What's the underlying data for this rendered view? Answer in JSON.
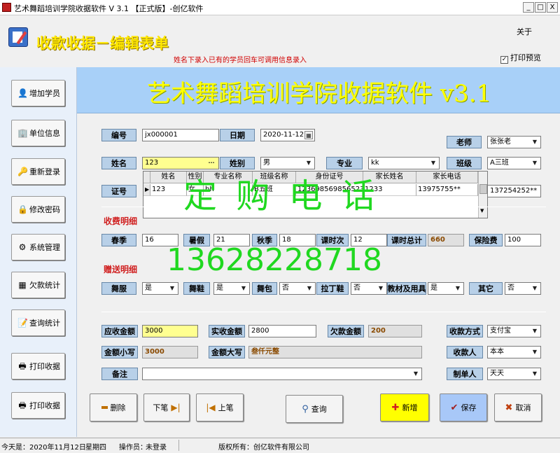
{
  "window": {
    "title": "艺术舞蹈培训学院收据软件 V 3.1 【正式版】-创亿软件",
    "btn_min": "_",
    "btn_max": "□",
    "btn_close": "X"
  },
  "header": {
    "title": "收款收据－编辑表单",
    "hint": "姓名下录入已有的学员回车可调用信息录入",
    "about": "关于",
    "print_preview": "打印预览",
    "print_preview_checked": "✓"
  },
  "banner": {
    "title": "艺术舞蹈培训学院收据软件 v3.1"
  },
  "sidebar": {
    "items": [
      {
        "label": "增加学员",
        "icon": "add-student-icon",
        "glyph": "👤"
      },
      {
        "label": "单位信息",
        "icon": "company-info-icon",
        "glyph": "🏢"
      },
      {
        "label": "重新登录",
        "icon": "relogin-icon",
        "glyph": "🔑"
      },
      {
        "label": "修改密码",
        "icon": "password-icon",
        "glyph": "🔒"
      },
      {
        "label": "系统管理",
        "icon": "system-icon",
        "glyph": "⚙"
      },
      {
        "label": "欠款统计",
        "icon": "debt-stat-icon",
        "glyph": "▦"
      },
      {
        "label": "查询统计",
        "icon": "query-stat-icon",
        "glyph": "📝"
      },
      {
        "label": "打印收据",
        "icon": "printer-icon",
        "glyph": "🖶"
      },
      {
        "label": "打印收据",
        "icon": "printer-icon",
        "glyph": "🖶"
      }
    ]
  },
  "form": {
    "number": {
      "label": "编号",
      "value": "jx000001"
    },
    "date": {
      "label": "日期",
      "value": "2020-11-12"
    },
    "teacher": {
      "label": "老师",
      "value": "张张老"
    },
    "name": {
      "label": "姓名",
      "value": "123",
      "ellipsis": "···"
    },
    "gender": {
      "label": "姓别",
      "value": "男"
    },
    "major": {
      "label": "专业",
      "value": "kk"
    },
    "class": {
      "label": "班级",
      "value": "A三班"
    },
    "id": {
      "label": "证号"
    },
    "phone_partial": "137254252**",
    "fees_section": "收费明细",
    "spring": {
      "label": "春季",
      "value": "16"
    },
    "summer": {
      "label": "暑假",
      "value": "21"
    },
    "autumn": {
      "label": "秋季",
      "value": "18"
    },
    "lesson_times": {
      "label": "课时次",
      "value": "12"
    },
    "lesson_total": {
      "label": "课时总计",
      "value": "660"
    },
    "insurance": {
      "label": "保险费",
      "value": "100"
    },
    "gift_section": "赠送明细",
    "dance_clothes": {
      "label": "舞服",
      "value": "是"
    },
    "dance_shoes": {
      "label": "舞鞋",
      "value": "是"
    },
    "dance_bag": {
      "label": "舞包",
      "value": "否"
    },
    "latin_shoes": {
      "label": "拉丁鞋",
      "value": "否"
    },
    "materials": {
      "label": "教材及用具",
      "value": "是"
    },
    "other": {
      "label": "其它",
      "value": "否"
    },
    "receivable": {
      "label": "应收金额",
      "value": "3000"
    },
    "received": {
      "label": "实收金额",
      "value": "2800"
    },
    "owed": {
      "label": "欠款金额",
      "value": "200"
    },
    "payment_method": {
      "label": "收款方式",
      "value": "支付宝"
    },
    "amount_lower": {
      "label": "金额小写",
      "value": "3000"
    },
    "amount_upper": {
      "label": "金额大写",
      "value": "叁仟元整"
    },
    "payee": {
      "label": "收款人",
      "value": "本本"
    },
    "remark": {
      "label": "备注",
      "value": ""
    },
    "maker": {
      "label": "制单人",
      "value": "天天"
    }
  },
  "grid": {
    "headers": [
      "姓名",
      "性别",
      "专业名称",
      "班级名称",
      "身份证号",
      "家长姓名",
      "家长电话"
    ],
    "row": [
      "123",
      "女",
      "hh",
      "B五班",
      "123698569856523",
      "1233",
      "13975755**"
    ],
    "marker": "▶"
  },
  "watermark": {
    "line1": "定 购 电 话",
    "line2": "13628228718"
  },
  "buttons": {
    "delete": "删除",
    "next": "下笔",
    "prev": "上笔",
    "query": "查询",
    "add": "新增",
    "save": "保存",
    "cancel": "取消"
  },
  "status": {
    "today_label": "今天是：",
    "date": "2020年11月12日",
    "weekday": "星期四",
    "operator_label": "操作员：",
    "operator": "未登录",
    "copyright": "版权所有：创亿软件有限公司"
  },
  "colors": {
    "banner_bg": "#a8d0f8",
    "title_yellow": "#ffe800",
    "label_bg": "#b8d0e8",
    "watermark": "#20d820",
    "add_button": "#ffff00",
    "save_button": "#a8c8f8"
  }
}
